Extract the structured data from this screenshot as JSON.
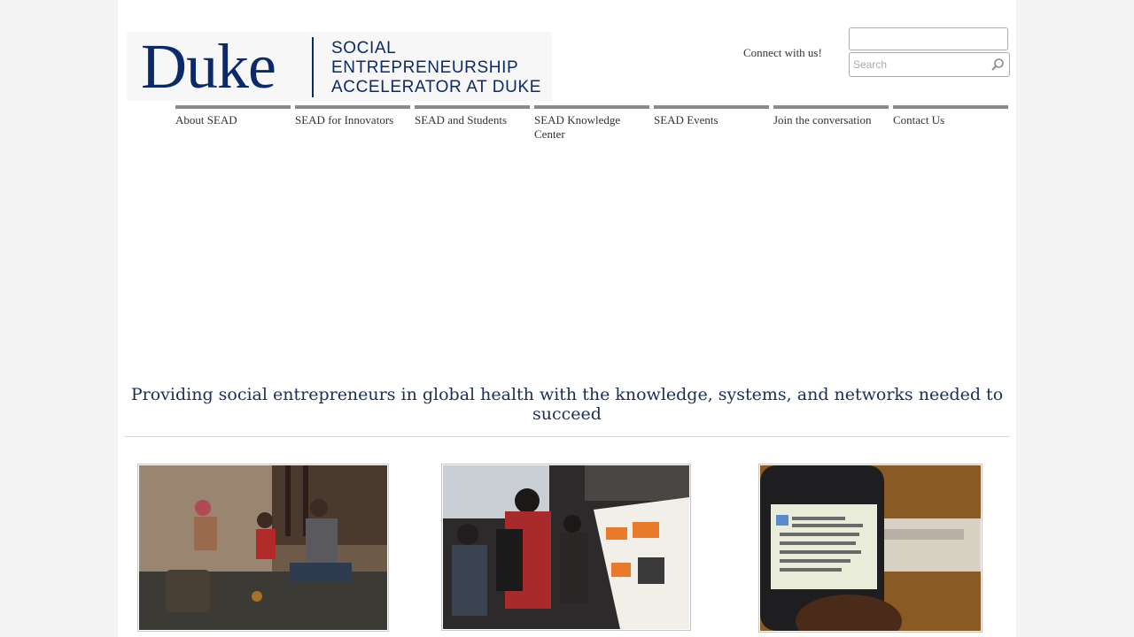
{
  "header": {
    "logo": {
      "wordmark": "Duke",
      "lines": [
        "SOCIAL",
        "ENTREPRENEURSHIP",
        "ACCELERATOR AT DUKE"
      ]
    },
    "connect_text": "Connect with us!",
    "search": {
      "placeholder": "Search",
      "icon": "search-icon"
    }
  },
  "nav": {
    "items": [
      {
        "label": "About SEAD"
      },
      {
        "label": "SEAD for Innovators"
      },
      {
        "label": "SEAD and Students"
      },
      {
        "label": "SEAD Knowledge Center"
      },
      {
        "label": "SEAD Events"
      },
      {
        "label": "Join the conversation"
      },
      {
        "label": "Contact Us"
      }
    ]
  },
  "main": {
    "tagline": "Providing social entrepreneurs in global health with the knowledge, systems, and networks needed to succeed"
  },
  "colors": {
    "brand_navy": "#0b2a6b",
    "nav_bar": "#8a8a8a",
    "tagline": "#1a2f55"
  }
}
